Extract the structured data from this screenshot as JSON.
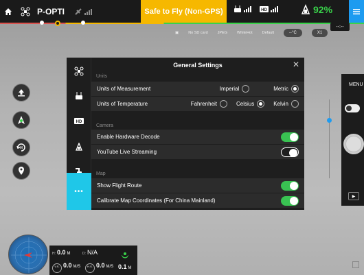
{
  "topbar": {
    "mode": "P-OPTI",
    "status": "Safe to Fly (Non-GPS)",
    "battery_pct": "92%",
    "colors": {
      "status": "#f6b800",
      "battery": "#39d24a",
      "menu": "#1d9bf0"
    }
  },
  "camera_params": {
    "sd": "No SD card",
    "format": "JPEG",
    "palette": "WhiteHot",
    "scene": "Default",
    "temp_btn": "-·°C",
    "zoom_btn": "X1",
    "timer": "--:--"
  },
  "right_panel": {
    "menu_label": "MENU"
  },
  "dialog": {
    "title": "General Settings",
    "sections": {
      "units": "Units",
      "camera": "Camera",
      "map": "Map"
    },
    "rows": {
      "units_measurement": {
        "label": "Units of Measurement",
        "options": [
          "Imperial",
          "Metric"
        ],
        "selected": "Metric"
      },
      "units_temperature": {
        "label": "Units of Temperature",
        "options": [
          "Fahrenheit",
          "Celsius",
          "Kelvin"
        ],
        "selected": "Celsius"
      },
      "hw_decode": {
        "label": "Enable Hardware Decode",
        "on": true
      },
      "youtube": {
        "label": "YouTube Live Streaming",
        "on": false
      },
      "flight_route": {
        "label": "Show Flight Route",
        "on": true
      },
      "calibrate_map": {
        "label": "Calibrate Map Coordinates (For China Mainland)",
        "on": true
      }
    },
    "sidebar_icons": [
      "aircraft-icon",
      "remote-controller-icon",
      "hd-icon",
      "battery-icon",
      "gimbal-icon",
      "more-icon"
    ],
    "colors": {
      "active_tab": "#1fc7e8",
      "switch_on": "#39c252"
    }
  },
  "telemetry": {
    "h_label": "H:",
    "h_value": "0.0",
    "h_unit": "M",
    "d_label": "D:",
    "d_value": "N/A",
    "vs_label": "V.S.",
    "vs_value": "0.0",
    "vs_unit": "M/S",
    "hs_label": "H.S.",
    "hs_value": "0.0",
    "hs_unit": "M/S",
    "vps_value": "0.1",
    "vps_unit": "M"
  }
}
